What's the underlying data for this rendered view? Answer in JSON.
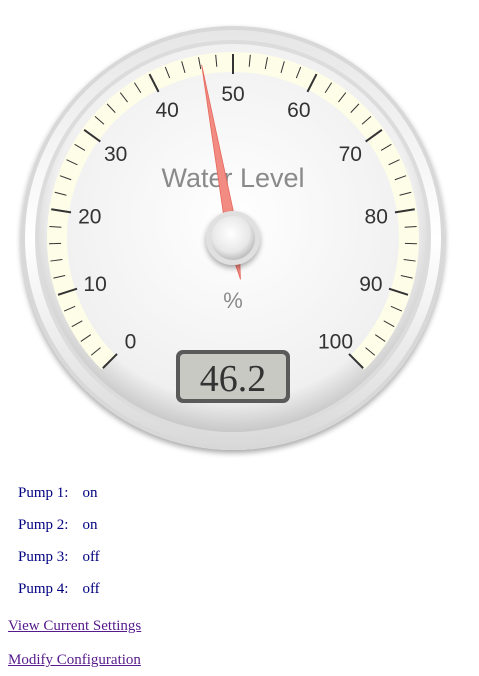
{
  "gauge": {
    "title": "Water Level",
    "units": "%",
    "value": 46.2,
    "value_text": "46.2",
    "min": 0,
    "max": 100,
    "major_ticks": [
      "0",
      "10",
      "20",
      "30",
      "40",
      "50",
      "60",
      "70",
      "80",
      "90",
      "100"
    ],
    "minor_ticks_per_major": 5,
    "colors": {
      "plate": "#ffffff",
      "highlight_band": "#fdfde8",
      "tick": "#333333",
      "label": "#333333",
      "title": "#8a8a8a",
      "needle": "#f28b82",
      "value_box_bg": "#c9c9c4",
      "value_box_border": "#555555",
      "value_text": "#333333"
    }
  },
  "pumps": [
    {
      "label": "Pump 1:",
      "state": "on"
    },
    {
      "label": "Pump 2:",
      "state": "on"
    },
    {
      "label": "Pump 3:",
      "state": "off"
    },
    {
      "label": "Pump 4:",
      "state": "off"
    }
  ],
  "links": {
    "view_settings": "View Current Settings",
    "modify_config": "Modify Configuration"
  }
}
